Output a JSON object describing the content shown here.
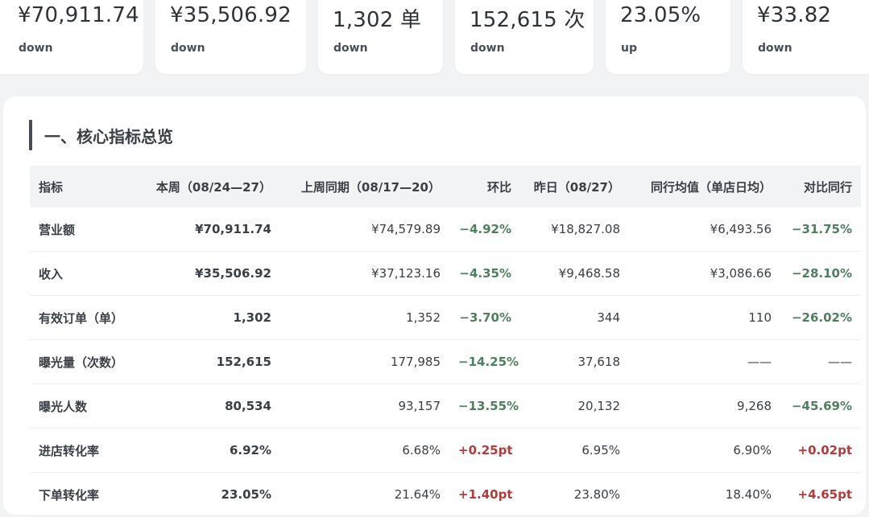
{
  "kpis": [
    {
      "value": "¥70,911.74",
      "trend": "down"
    },
    {
      "value": "¥35,506.92",
      "trend": "down"
    },
    {
      "value": "1,302 单",
      "trend": "down"
    },
    {
      "value": "152,615 次",
      "trend": "down"
    },
    {
      "value": "23.05%",
      "trend": "up"
    },
    {
      "value": "¥33.82",
      "trend": "down"
    }
  ],
  "section": {
    "title": "一、核心指标总览"
  },
  "table": {
    "headers": [
      "指标",
      "本周（08/24—27）",
      "上周同期（08/17—20）",
      "环比",
      "昨日（08/27）",
      "同行均值（单店日均）",
      "对比同行"
    ],
    "rows": [
      {
        "cells": [
          "营业额",
          "¥70,911.74",
          "¥74,579.89",
          "−4.92%",
          "¥18,827.08",
          "¥6,493.56",
          "−31.75%"
        ],
        "tones": [
          "neg",
          "neg"
        ]
      },
      {
        "cells": [
          "收入",
          "¥35,506.92",
          "¥37,123.16",
          "−4.35%",
          "¥9,468.58",
          "¥3,086.66",
          "−28.10%"
        ],
        "tones": [
          "neg",
          "neg"
        ]
      },
      {
        "cells": [
          "有效订单（单）",
          "1,302",
          "1,352",
          "−3.70%",
          "344",
          "110",
          "−26.02%"
        ],
        "tones": [
          "neg",
          "neg"
        ]
      },
      {
        "cells": [
          "曝光量（次数）",
          "152,615",
          "177,985",
          "−14.25%",
          "37,618",
          "——",
          "——"
        ],
        "tones": [
          "neg",
          "neu"
        ]
      },
      {
        "cells": [
          "曝光人数",
          "80,534",
          "93,157",
          "−13.55%",
          "20,132",
          "9,268",
          "−45.69%"
        ],
        "tones": [
          "neg",
          "neg"
        ]
      },
      {
        "cells": [
          "进店转化率",
          "6.92%",
          "6.68%",
          "+0.25pt",
          "6.95%",
          "6.90%",
          "+0.02pt"
        ],
        "tones": [
          "pos",
          "pos"
        ]
      },
      {
        "cells": [
          "下单转化率",
          "23.05%",
          "21.64%",
          "+1.40pt",
          "23.80%",
          "18.40%",
          "+4.65pt"
        ],
        "tones": [
          "pos",
          "pos"
        ]
      }
    ]
  },
  "colors": {
    "negative": "#4f7f5e",
    "positive": "#b23b3b",
    "accent_bar": "#474c55"
  }
}
